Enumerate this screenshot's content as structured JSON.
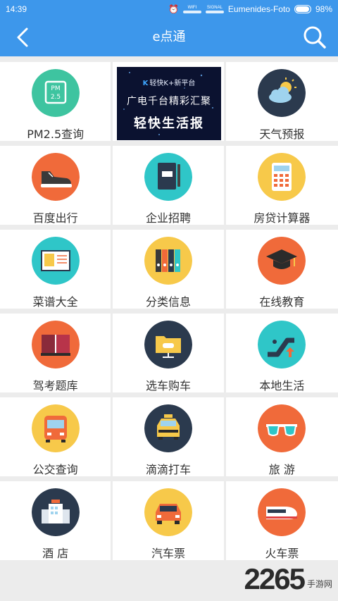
{
  "status": {
    "time": "14:39",
    "wifi_label": "WIFI",
    "signal_label": "SIGNAL",
    "carrier": "Eumenides-Foto",
    "battery": "98%"
  },
  "header": {
    "title": "e点通"
  },
  "banner": {
    "brand": "轻快K+新平台",
    "line2": "广电千台精彩汇聚",
    "line3": "轻快生活报"
  },
  "items": [
    {
      "label": "PM2.5查询",
      "icon": "pm25-icon",
      "color": "#3ec4a0"
    },
    {
      "label": "天气预报",
      "icon": "weather-icon",
      "color": "#2b3a4e"
    },
    {
      "label": "百度出行",
      "icon": "sneaker-icon",
      "color": "#f06a3a"
    },
    {
      "label": "企业招聘",
      "icon": "notebook-icon",
      "color": "#2fc6c8"
    },
    {
      "label": "房贷计算器",
      "icon": "calculator-icon",
      "color": "#f7c94a"
    },
    {
      "label": "菜谱大全",
      "icon": "recipe-board-icon",
      "color": "#2fc6c8"
    },
    {
      "label": "分类信息",
      "icon": "binders-icon",
      "color": "#f7c94a"
    },
    {
      "label": "在线教育",
      "icon": "graduation-cap-icon",
      "color": "#f06a3a"
    },
    {
      "label": "驾考题库",
      "icon": "book-icon",
      "color": "#f06a3a"
    },
    {
      "label": "选车购车",
      "icon": "folder-car-icon",
      "color": "#2b3a4e"
    },
    {
      "label": "本地生活",
      "icon": "escalator-icon",
      "color": "#2fc6c8"
    },
    {
      "label": "公交查询",
      "icon": "bus-icon",
      "color": "#f7c94a"
    },
    {
      "label": "滴滴打车",
      "icon": "taxi-icon",
      "color": "#2b3a4e"
    },
    {
      "label": "旅  游",
      "icon": "sunglasses-icon",
      "color": "#f06a3a"
    },
    {
      "label": "酒  店",
      "icon": "hotel-icon",
      "color": "#2b3a4e"
    },
    {
      "label": "汽车票",
      "icon": "car-icon",
      "color": "#f7c94a"
    },
    {
      "label": "火车票",
      "icon": "train-icon",
      "color": "#f06a3a"
    }
  ],
  "watermark": {
    "number": "2265",
    "site": "手游网"
  }
}
